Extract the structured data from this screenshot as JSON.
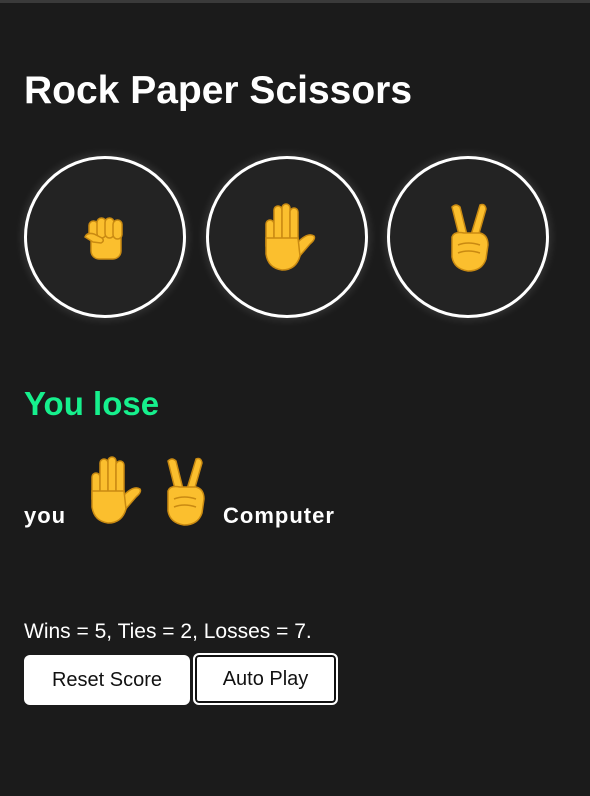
{
  "title": "Rock Paper Scissors",
  "move_buttons": [
    {
      "name": "rock",
      "icon": "fist-icon"
    },
    {
      "name": "paper",
      "icon": "raised-hand-icon"
    },
    {
      "name": "scissors",
      "icon": "victory-hand-icon"
    }
  ],
  "result": {
    "text": "You lose",
    "color": "#16f08d"
  },
  "moves": {
    "player_label": "you",
    "player_move_icon": "raised-hand-icon",
    "computer_move_icon": "victory-hand-icon",
    "computer_label": "Computer"
  },
  "score": {
    "text": "Wins = 5, Ties = 2, Losses = 7."
  },
  "buttons": {
    "reset_label": "Reset Score",
    "auto_label": "Auto Play"
  },
  "colors": {
    "background": "#1b1b1b",
    "emoji_yellow": "#fbbf2e",
    "button_border": "#ffffff"
  }
}
